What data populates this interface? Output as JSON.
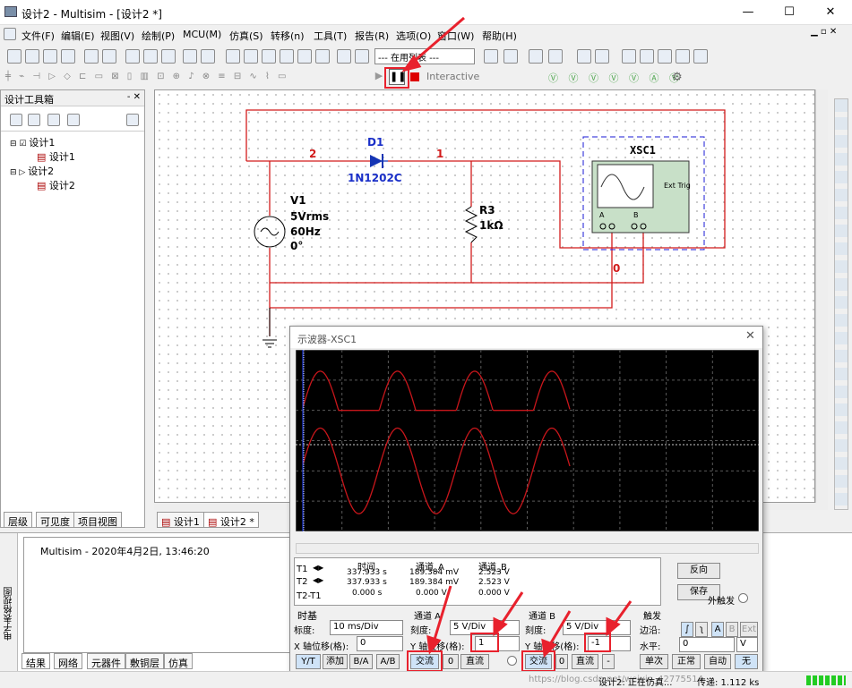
{
  "window": {
    "title": "设计2 - Multisim - [设计2 *]",
    "min": "—",
    "max": "☐",
    "close": "✕"
  },
  "menu": [
    "文件(F)",
    "编辑(E)",
    "视图(V)",
    "绘制(P)",
    "MCU(M)",
    "仿真(S)",
    "转移(n)",
    "工具(T)",
    "报告(R)",
    "选项(O)",
    "窗口(W)",
    "帮助(H)"
  ],
  "toolbar": {
    "dropdown": "--- 在用列表 ---",
    "interactive": "Interactive"
  },
  "toolbox": {
    "title": "设计工具箱",
    "tree": [
      {
        "label": "设计1",
        "level": 0
      },
      {
        "label": "设计1",
        "level": 1
      },
      {
        "label": "设计2",
        "level": 0
      },
      {
        "label": "设计2",
        "level": 1
      }
    ],
    "tabs": [
      "层级",
      "可见度",
      "项目视图"
    ]
  },
  "circuit": {
    "d1_name": "D1",
    "d1_model": "1N1202C",
    "node2": "2",
    "node1": "1",
    "node0": "0",
    "v1_name": "V1",
    "v1_amp": "5Vrms",
    "v1_freq": "60Hz",
    "v1_phase": "0°",
    "r3_name": "R3",
    "r3_val": "1kΩ",
    "xsc_name": "XSC1",
    "xsc_exttrig": "Ext Trig",
    "xsc_a": "A",
    "xsc_b": "B"
  },
  "doc_tabs": [
    "设计1",
    "设计2 *"
  ],
  "log": {
    "text": "Multisim  -  2020年4月2日, 13:46:20",
    "side_label": "电子表格视图",
    "tabs": [
      "结果",
      "网络",
      "元器件",
      "敷铜层",
      "仿真"
    ]
  },
  "osc": {
    "title": "示波器-XSC1",
    "readout_headers": [
      "时间",
      "通道_A",
      "通道_B"
    ],
    "rows": [
      {
        "label": "T1",
        "time": "337.933 s",
        "a": "189.384 mV",
        "b": "2.523 V"
      },
      {
        "label": "T2",
        "time": "337.933 s",
        "a": "189.384 mV",
        "b": "2.523 V"
      },
      {
        "label": "T2-T1",
        "time": "0.000 s",
        "a": "0.000 V",
        "b": "0.000 V"
      }
    ],
    "reverse": "反向",
    "save": "保存",
    "ext_trigger": "外触发",
    "timebase": {
      "title": "时基",
      "scale_label": "标度:",
      "scale": "10 ms/Div",
      "xpos_label": "X 轴位移(格):",
      "xpos": "0",
      "buttons": [
        "Y/T",
        "添加",
        "B/A",
        "A/B"
      ]
    },
    "chA": {
      "title": "通道 A",
      "scale_label": "刻度:",
      "scale": "5  V/Div",
      "ypos_label": "Y 轴位移(格):",
      "ypos": "1",
      "ac": "交流",
      "zero": "0",
      "dc": "直流"
    },
    "chB": {
      "title": "通道 B",
      "scale_label": "刻度:",
      "scale": "5  V/Div",
      "ypos_label": "Y 轴位移(格):",
      "ypos": "-1",
      "ac": "交流",
      "zero": "0",
      "dc": "直流",
      "minus": "-"
    },
    "trigger": {
      "title": "触发",
      "edge_label": "边沿:",
      "level_label": "水平:",
      "level": "0",
      "unit": "V",
      "edge_buttons": [
        "A",
        "B",
        "Ext"
      ],
      "modes": [
        "单次",
        "正常",
        "自动",
        "无"
      ]
    }
  },
  "status": {
    "sim": "设计2: 正在仿真...",
    "transfer": "传递: 1.112 ks",
    "watermark": "https://blog.csdn.net/weixin_42775514"
  }
}
